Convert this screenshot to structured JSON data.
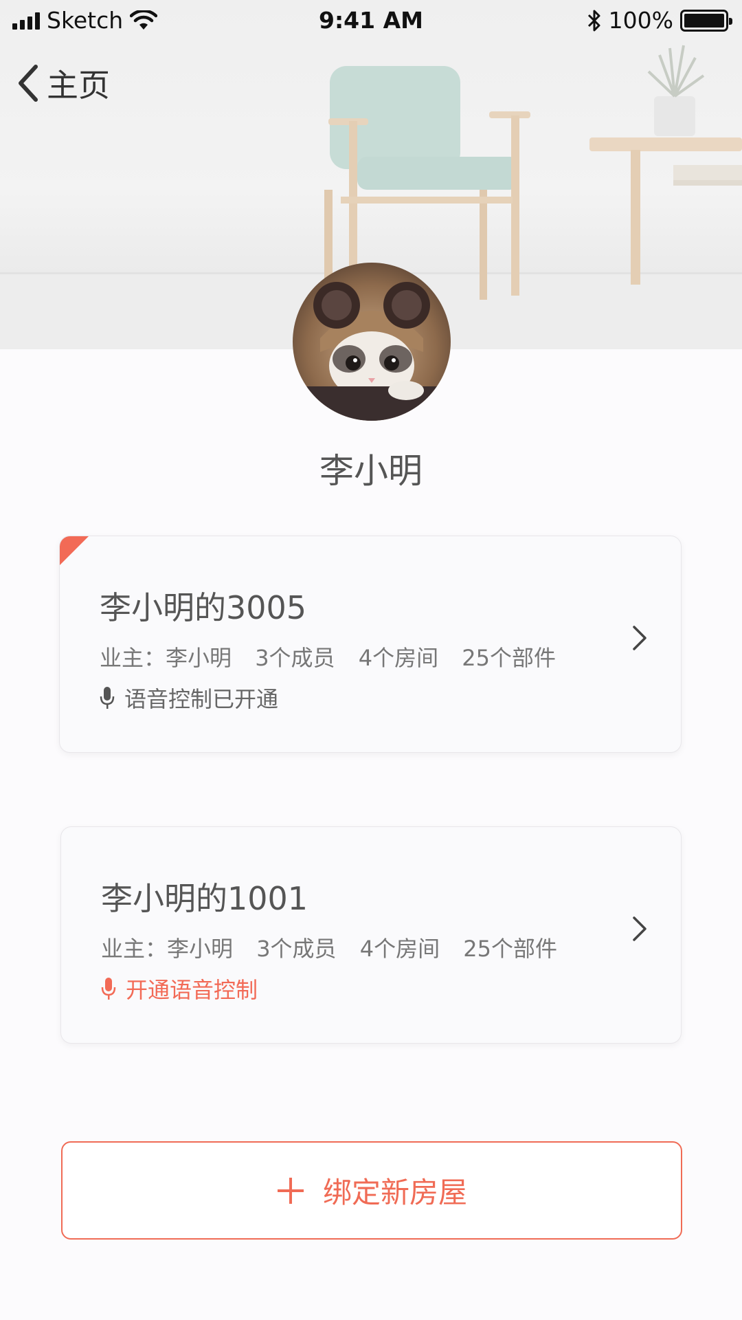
{
  "status_bar": {
    "carrier": "Sketch",
    "time": "9:41 AM",
    "battery": "100%"
  },
  "nav": {
    "back_label": "主页"
  },
  "profile": {
    "name": "李小明"
  },
  "houses": [
    {
      "title": "李小明的3005",
      "owner": "业主：李小明",
      "members": "3个成员",
      "rooms": "4个房间",
      "parts": "25个部件",
      "voice_status": "语音控制已开通",
      "voice_enabled": true,
      "flagged": true
    },
    {
      "title": "李小明的1001",
      "owner": "业主：李小明",
      "members": "3个成员",
      "rooms": "4个房间",
      "parts": "25个部件",
      "voice_status": "开通语音控制",
      "voice_enabled": false,
      "flagged": false
    }
  ],
  "actions": {
    "bind_new_house": "绑定新房屋"
  },
  "colors": {
    "accent": "#f06b55",
    "text": "#555555",
    "card_bg": "#fafafc"
  },
  "icons": {
    "back": "chevron-left-icon",
    "voice": "microphone-icon",
    "enter": "chevron-right-icon",
    "add": "plus-icon"
  }
}
